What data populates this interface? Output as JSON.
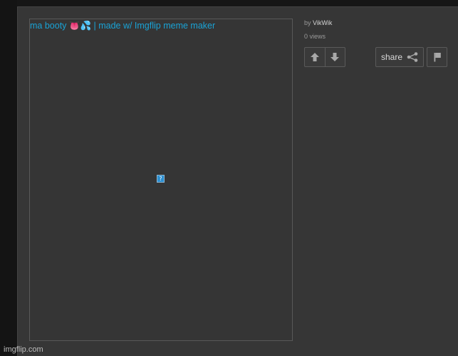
{
  "image": {
    "alt_text": "ma booty 👅💦 | made w/ Imgflip meme maker",
    "broken_icon_glyph": "?"
  },
  "meta": {
    "by_label": "by",
    "username": "VikWik",
    "views": "0 views"
  },
  "actions": {
    "upvote_icon": "arrow-up-icon",
    "downvote_icon": "arrow-down-icon",
    "share_label": "share",
    "share_icon": "share-icon",
    "flag_icon": "flag-icon"
  },
  "footer": {
    "watermark": "imgflip.com"
  },
  "colors": {
    "page_bg": "#161616",
    "panel_bg": "#363636",
    "link_blue": "#19a3d6",
    "icon_gray": "#a8a8a8"
  }
}
